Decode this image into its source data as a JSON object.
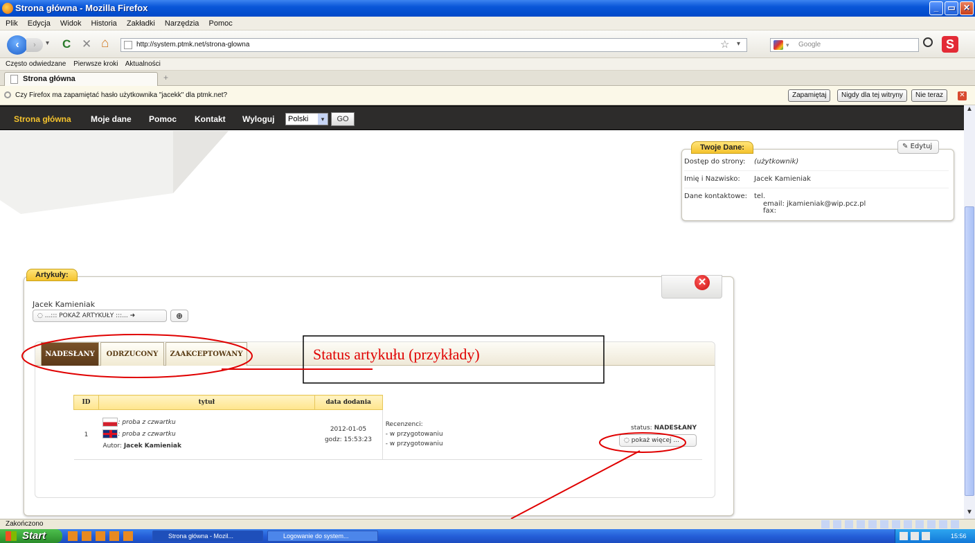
{
  "window": {
    "title": "Strona główna - Mozilla Firefox",
    "min": "_",
    "max": "▭",
    "close": "✕"
  },
  "menu": [
    "Plik",
    "Edycja",
    "Widok",
    "Historia",
    "Zakładki",
    "Narzędzia",
    "Pomoc"
  ],
  "nav": {
    "url": "http://system.ptmk.net/strona-glowna",
    "search_placeholder": "Google",
    "back": "‹",
    "forward": "›",
    "reload": "C",
    "stop": "✕",
    "home": "⌂",
    "star": "☆",
    "dd": "▾"
  },
  "bookmarks": [
    "Często odwiedzane",
    "Pierwsze kroki",
    "Aktualności"
  ],
  "tabs": {
    "active": "Strona główna",
    "new": "+"
  },
  "password_bar": {
    "message": "Czy Firefox ma zapamiętać hasło użytkownika \"jacekk\" dla ptmk.net?",
    "remember": "Zapamiętaj",
    "never": "Nigdy dla tej witryny",
    "not_now": "Nie teraz"
  },
  "site_nav": {
    "items": [
      "Strona główna",
      "Moje dane",
      "Pomoc",
      "Kontakt",
      "Wyloguj"
    ],
    "language": "Polski",
    "go": "GO"
  },
  "user_panel": {
    "tag": "Twoje Dane:",
    "edit": "Edytuj",
    "access_label": "Dostęp do strony:",
    "access_value": "użytkownik",
    "name_label": "Imię i Nazwisko:",
    "name_value": "Jacek Kamieniak",
    "contact_label": "Dane kontaktowe:",
    "tel": "tel.",
    "email": "email: jkamieniak@wip.pcz.pl",
    "fax": "fax:"
  },
  "articles": {
    "tag": "Artykuły:",
    "author_name": "Jacek Kamieniak",
    "show_button": "...::: POKAŻ ARTYKUŁY :::...",
    "status_tabs": [
      "NADESŁANY",
      "ODRZUCONY",
      "ZAAKCEPTOWANY"
    ],
    "annotation": "Status artykułu (przykłady)",
    "table": {
      "headers": [
        "ID",
        "tytuł",
        "data dodania"
      ],
      "row": {
        "id": "1",
        "title_pl": ": proba z czwartku",
        "title_en": ": proba z czwartku",
        "author_label": "Autor:",
        "author": "Jacek Kamieniak",
        "date": "2012-01-05",
        "time": "godz: 15:53:23",
        "reviewers_label": "Recenzenci:",
        "reviewer1": "- w przygotowaniu",
        "reviewer2": "- w przygotowaniu",
        "status_label": "status:",
        "status": "NADESŁANY",
        "more": "pokaż więcej ..."
      }
    }
  },
  "status_bar": "Zakończono",
  "taskbar": {
    "start": "Start",
    "tasks": [
      "Strona główna - Mozil...",
      "Logowanie do system..."
    ],
    "clock": "15:56"
  },
  "colors": {
    "annotation_red": "#e00000",
    "site_nav_active": "#f5c32d"
  }
}
